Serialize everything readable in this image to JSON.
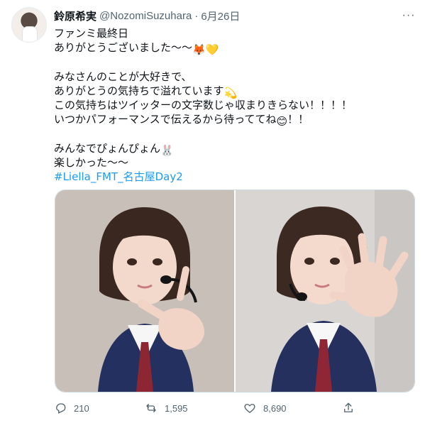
{
  "tweet": {
    "author_name": "鈴原希実",
    "handle": "@NozomiSuzuhara",
    "separator": "·",
    "date": "6月26日",
    "more_icon": "more-dots-icon",
    "lines": [
      "ファンミ最終日",
      "ありがとうございました〜〜",
      "みなさんのことが大好きで、",
      "ありがとうの気持ちで溢れています",
      "この気持ちはツイッターの文字数じゃ収まりきらない！！！！",
      "いつかパフォーマンスで伝えるから待っててね",
      "！！",
      "みんなでぴょんぴょん",
      "楽しかった〜〜"
    ],
    "emoji": {
      "fox": "🦊",
      "heart": "💛",
      "sparkle": "💫",
      "smile": "😊",
      "rabbit": "🐰"
    },
    "hashtag": "#Liella_FMT_名古屋Day2",
    "photos": [
      "photo-left",
      "photo-right"
    ],
    "actions": {
      "reply_count": "210",
      "retweet_count": "1,595",
      "like_count": "8,690"
    },
    "colors": {
      "hashtag": "#1d9bf0",
      "secondary_text": "#536471",
      "border": "#cfd9de"
    }
  }
}
